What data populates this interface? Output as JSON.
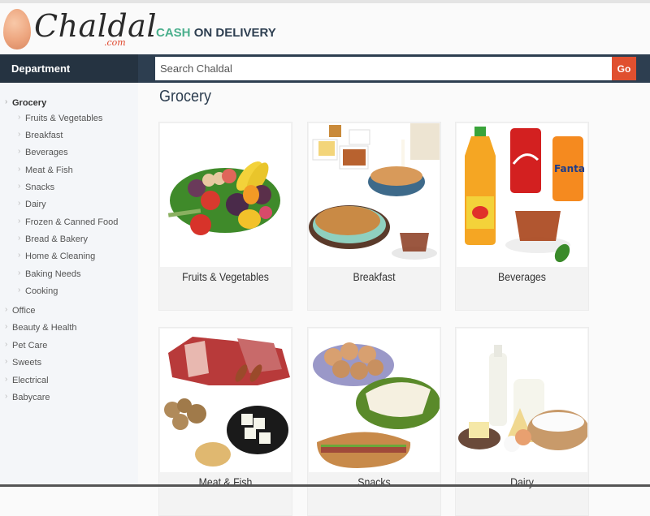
{
  "header": {
    "logo_text": "Chaldal",
    "logo_suffix": ".com",
    "tagline_highlight": "CASH",
    "tagline_rest": "ON DELIVERY"
  },
  "navbar": {
    "department_label": "Department",
    "search_placeholder": "Search Chaldal",
    "search_value": "",
    "go_label": "Go"
  },
  "colors": {
    "navy": "#2d3e50",
    "accent_green": "#4aaf8c",
    "go_button": "#e0502f"
  },
  "sidebar": {
    "categories": [
      {
        "label": "Grocery",
        "expanded": true,
        "children": [
          "Fruits & Vegetables",
          "Breakfast",
          "Beverages",
          "Meat & Fish",
          "Snacks",
          "Dairy",
          "Frozen & Canned Food",
          "Bread & Bakery",
          "Home & Cleaning",
          "Baking Needs",
          "Cooking"
        ]
      },
      {
        "label": "Office"
      },
      {
        "label": "Beauty & Health"
      },
      {
        "label": "Pet Care"
      },
      {
        "label": "Sweets"
      },
      {
        "label": "Electrical"
      },
      {
        "label": "Babycare"
      }
    ]
  },
  "main": {
    "title": "Grocery",
    "cards": [
      {
        "label": "Fruits & Vegetables",
        "image": "fruits-vegetables-image"
      },
      {
        "label": "Breakfast",
        "image": "breakfast-image"
      },
      {
        "label": "Beverages",
        "image": "beverages-image"
      },
      {
        "label": "Meat & Fish",
        "image": "meat-fish-image"
      },
      {
        "label": "Snacks",
        "image": "snacks-image"
      },
      {
        "label": "Dairy",
        "image": "dairy-image"
      }
    ]
  }
}
